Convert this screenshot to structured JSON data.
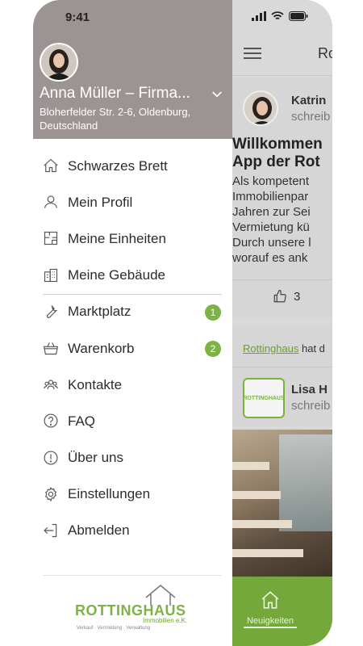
{
  "status_bar": {
    "time": "9:41"
  },
  "drawer": {
    "user_name": "Anna Müller – Firma...",
    "user_address": "Bloherfelder Str. 2-6, Oldenburg, Deutschland",
    "menu": [
      {
        "label": "Schwarzes Brett",
        "icon": "home-icon"
      },
      {
        "label": "Mein Profil",
        "icon": "user-icon"
      },
      {
        "label": "Meine Einheiten",
        "icon": "floorplan-icon"
      },
      {
        "label": "Meine Gebäude",
        "icon": "building-icon"
      },
      {
        "label": "Marktplatz",
        "icon": "wrench-icon",
        "badge": "1"
      },
      {
        "label": "Warenkorb",
        "icon": "basket-icon",
        "badge": "2"
      },
      {
        "label": "Kontakte",
        "icon": "contacts-icon"
      },
      {
        "label": "FAQ",
        "icon": "question-icon"
      },
      {
        "label": "Über uns",
        "icon": "info-icon"
      },
      {
        "label": "Einstellungen",
        "icon": "gear-icon"
      },
      {
        "label": "Abmelden",
        "icon": "logout-icon"
      }
    ],
    "logo": {
      "name": "ROTTINGHAUS",
      "sub": "Immobilien e.K.",
      "tagline": "Verkauf · Vermietung · Verwaltung"
    }
  },
  "background": {
    "page_title": "Ro",
    "post1": {
      "author": "Katrin",
      "subtitle": "schreib",
      "title_lines": [
        "Willkommen",
        "App der Rot"
      ],
      "body_lines": [
        "Als kompetent",
        "Immobilienpar",
        "Jahren zur Sei",
        "Vermietung kü",
        "Durch unsere l",
        "worauf es ank"
      ],
      "likes": "3"
    },
    "post2": {
      "link": "Rottinghaus",
      "note_rest": " hat d",
      "author": "Lisa H",
      "subtitle": "schreib",
      "logo_text": "ROTTINGHAUS"
    },
    "tab": {
      "label": "Neuigkeiten"
    }
  },
  "colors": {
    "accent_green": "#7cb342",
    "drawer_header": "#9b9493",
    "tabbar": "#74a83a"
  }
}
